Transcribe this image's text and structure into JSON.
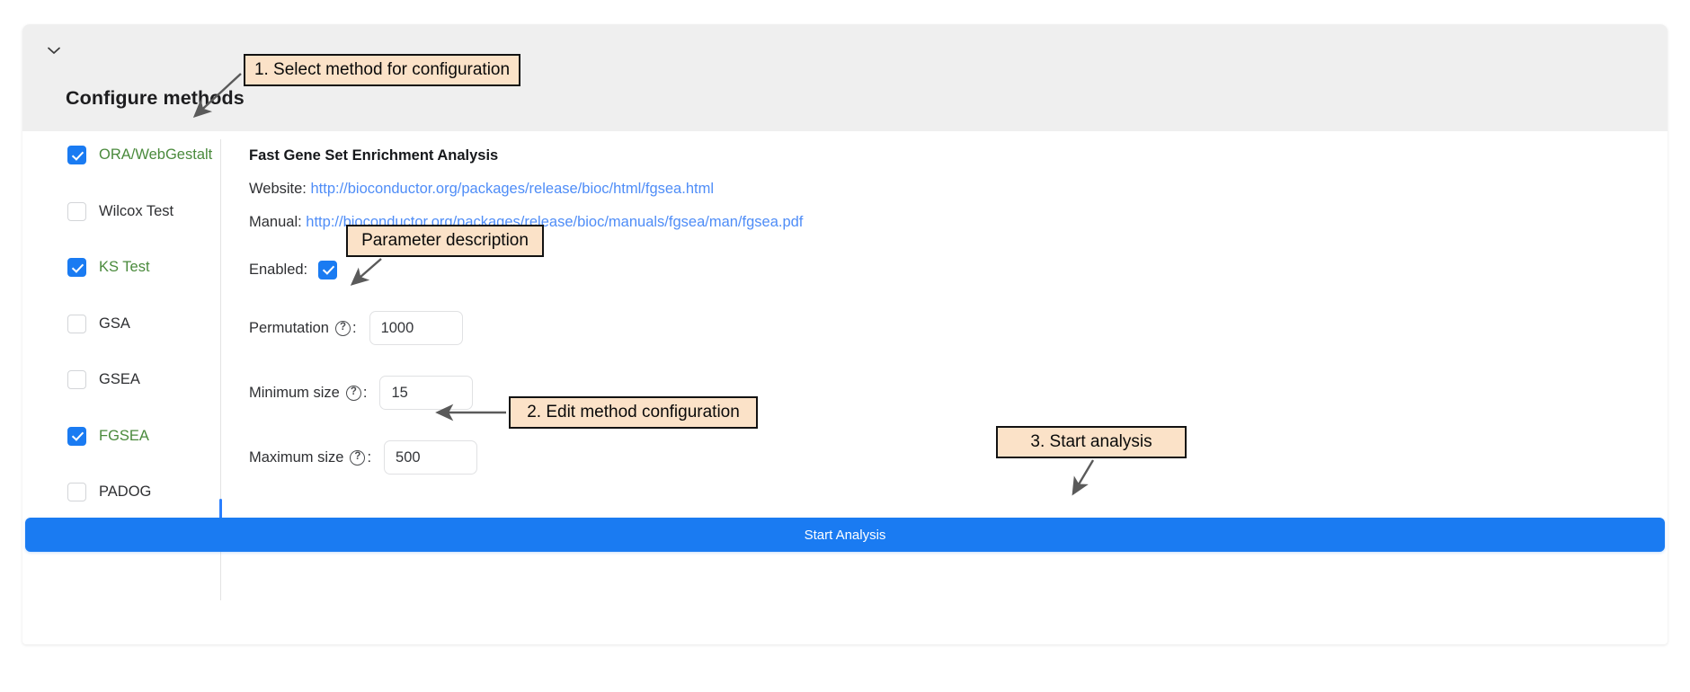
{
  "card": {
    "title": "Configure methods",
    "collapse_icon": "chevron-down-icon"
  },
  "methods": [
    {
      "label": "ORA/WebGestalt",
      "checked": true,
      "selected": false
    },
    {
      "label": "Wilcox Test",
      "checked": false,
      "selected": false
    },
    {
      "label": "KS Test",
      "checked": true,
      "selected": false
    },
    {
      "label": "GSA",
      "checked": false,
      "selected": false
    },
    {
      "label": "GSEA",
      "checked": false,
      "selected": false
    },
    {
      "label": "FGSEA",
      "checked": true,
      "selected": true
    },
    {
      "label": "PADOG",
      "checked": false,
      "selected": false
    }
  ],
  "detail": {
    "title": "Fast Gene Set Enrichment Analysis",
    "website_label": "Website:",
    "website_url": "http://bioconductor.org/packages/release/bioc/html/fgsea.html",
    "manual_label": "Manual:",
    "manual_url": "http://bioconductor.org/packages/release/bioc/manuals/fgsea/man/fgsea.pdf",
    "enabled_label": "Enabled:",
    "enabled_checked": true,
    "help_glyph": "?",
    "params": [
      {
        "label": "Permutation",
        "value": "1000",
        "help": "?"
      },
      {
        "label": "Minimum size",
        "value": "15",
        "help": "?"
      },
      {
        "label": "Maximum size",
        "value": "500",
        "help": "?"
      }
    ]
  },
  "actions": {
    "start_analysis": "Start Analysis"
  },
  "annotations": [
    {
      "id": "callout-1",
      "text": "1. Select method for configuration"
    },
    {
      "id": "callout-2",
      "text": "Parameter description"
    },
    {
      "id": "callout-3",
      "text": "2. Edit method configuration"
    },
    {
      "id": "callout-4",
      "text": "3. Start analysis"
    }
  ],
  "colors": {
    "accent_blue": "#1a7bf2",
    "link_blue": "#4f8df7",
    "checked_label_green": "#4a8a3c",
    "callout_fill": "#fbe2c8",
    "header_gray": "#efefef",
    "arrow_gray": "#5a5a5a"
  }
}
